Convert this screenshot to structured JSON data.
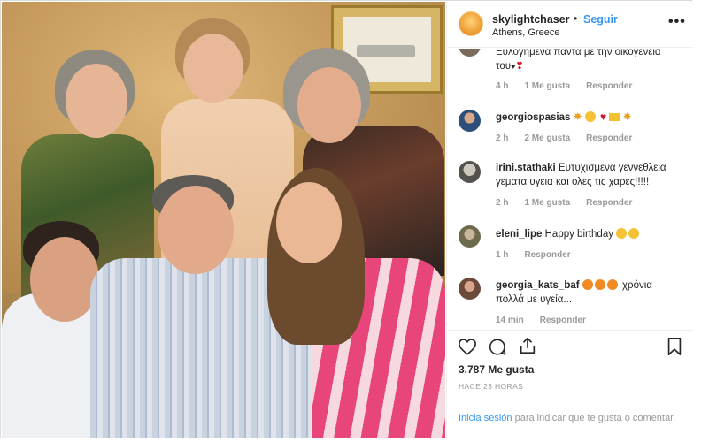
{
  "post": {
    "username": "skylightchaser",
    "follow_label": "Seguir",
    "location": "Athens, Greece",
    "more_label": "•••"
  },
  "comments": [
    {
      "username": "",
      "text_line1": "Ευλογημενα παντα με την οικογενεια",
      "text_line2": "του",
      "time": "4 h",
      "likes": "1 Me gusta",
      "reply": "Responder"
    },
    {
      "username": "georgiospasias",
      "text": "",
      "time": "2 h",
      "likes": "2 Me gusta",
      "reply": "Responder"
    },
    {
      "username": "irini.stathaki",
      "text_line1": "Ευτυχισμενα γεννεθλεια",
      "text_line2": "γεματα υγεια και ολες τις χαρες!!!!!",
      "time": "2 h",
      "likes": "1 Me gusta",
      "reply": "Responder"
    },
    {
      "username": "eleni_lipe",
      "text": "Happy birthday",
      "time": "1 h",
      "reply": "Responder"
    },
    {
      "username": "georgia_kats_baf",
      "text_line1": "χρόνια",
      "text_line2": "πολλά με υγεία...",
      "time": "14 min",
      "reply": "Responder"
    }
  ],
  "actions": {
    "likes_count": "3.787 Me gusta",
    "time_ago": "HACE 23 HORAS",
    "login_link": "Inicia sesión",
    "login_rest": " para indicar que te gusta o comentar."
  },
  "icons": {
    "like": "heart-icon",
    "comment": "comment-icon",
    "share": "share-icon",
    "save": "bookmark-icon",
    "more": "more-options-icon"
  },
  "colors": {
    "link": "#3897f0",
    "text": "#262626",
    "muted": "#999999",
    "border": "#dbdbdb",
    "avatar_accent": "#f0a43b"
  }
}
